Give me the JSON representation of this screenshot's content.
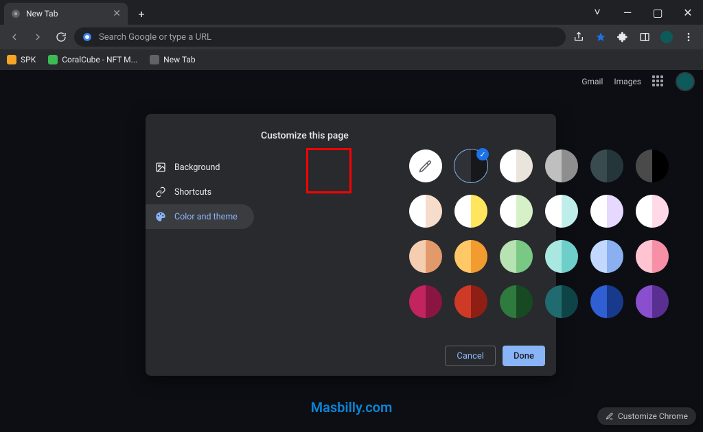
{
  "window": {
    "tab_title": "New Tab",
    "new_tab_plus": "+",
    "controls": {
      "min": "—",
      "max": "▢",
      "close": "✕",
      "chev": "˅"
    }
  },
  "toolbar": {
    "search_placeholder": "Search Google or type a URL"
  },
  "bookmarks": [
    {
      "label": "SPK",
      "color": "#f5a623"
    },
    {
      "label": "CoralCube - NFT M...",
      "color": "#3cba54"
    },
    {
      "label": "New Tab",
      "color": "#5f6368"
    }
  ],
  "page_links": {
    "gmail": "Gmail",
    "images": "Images"
  },
  "dialog": {
    "title": "Customize this page",
    "nav": [
      {
        "id": "background",
        "label": "Background"
      },
      {
        "id": "shortcuts",
        "label": "Shortcuts"
      },
      {
        "id": "theme",
        "label": "Color and theme"
      }
    ],
    "active_nav": "theme",
    "buttons": {
      "cancel": "Cancel",
      "done": "Done"
    },
    "swatches": [
      [
        {
          "type": "picker"
        },
        {
          "l": "#2f3136",
          "r": "#17181b",
          "selected": true
        },
        {
          "l": "#ffffff",
          "r": "#e9e4dc"
        },
        {
          "l": "#bfbfbf",
          "r": "#8e8e8e"
        },
        {
          "l": "#3a4b50",
          "r": "#25363b"
        },
        {
          "l": "#4a4a4a",
          "r": "#000000"
        }
      ],
      [
        {
          "l": "#ffffff",
          "r": "#f6dccb"
        },
        {
          "l": "#ffffff",
          "r": "#ffe65e"
        },
        {
          "l": "#ffffff",
          "r": "#d6f1c7"
        },
        {
          "l": "#ffffff",
          "r": "#bfeeea"
        },
        {
          "l": "#ffffff",
          "r": "#e6d8ff"
        },
        {
          "l": "#ffffff",
          "r": "#ffd9e8"
        }
      ],
      [
        {
          "l": "#f5cdb0",
          "r": "#e39a6a"
        },
        {
          "l": "#ffc766",
          "r": "#f29b2e"
        },
        {
          "l": "#b7e2b1",
          "r": "#79c884"
        },
        {
          "l": "#a8e8e1",
          "r": "#6ecfca"
        },
        {
          "l": "#c3d8ff",
          "r": "#8bb0f2"
        },
        {
          "l": "#ffc3d1",
          "r": "#f78fa7"
        }
      ],
      [
        {
          "l": "#c2245f",
          "r": "#8a1543"
        },
        {
          "l": "#cf3a27",
          "r": "#8f1f14"
        },
        {
          "l": "#2f7a3d",
          "r": "#174a22"
        },
        {
          "l": "#1f6b6f",
          "r": "#0f4447"
        },
        {
          "l": "#2f5fd3",
          "r": "#173a8d"
        },
        {
          "l": "#8a4fcf",
          "r": "#5a2f92"
        }
      ]
    ]
  },
  "customize_pill": "Customize Chrome",
  "watermark": "Masbilly.com"
}
